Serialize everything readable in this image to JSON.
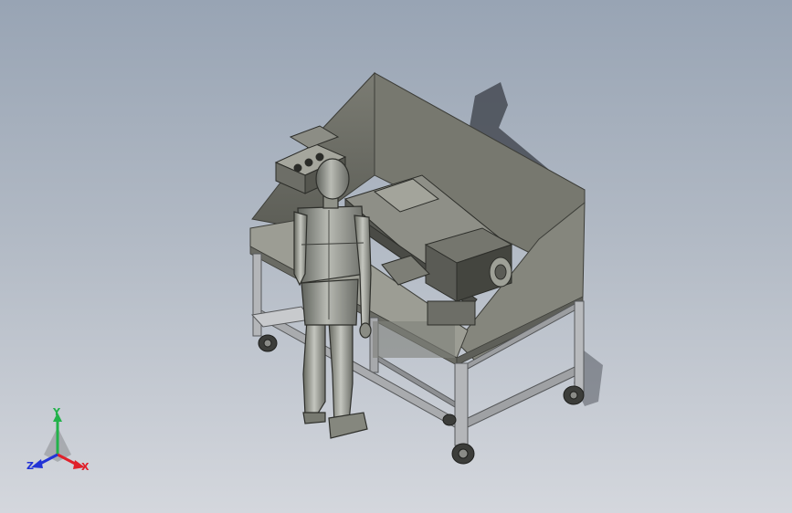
{
  "viewport": {
    "background_top": "#98a4b4",
    "background_bottom": "#d4d7dd"
  },
  "model": {
    "description_icon": "workstation-with-mannequin-icon",
    "metal_color": "#6c6e66",
    "frame_color": "#a9abae",
    "panel_color": "#8e8f87"
  },
  "triad": {
    "x_label": "X",
    "y_label": "Y",
    "z_label": "Z",
    "x_color": "#e0202a",
    "y_color": "#22b24a",
    "z_color": "#2233d6"
  }
}
